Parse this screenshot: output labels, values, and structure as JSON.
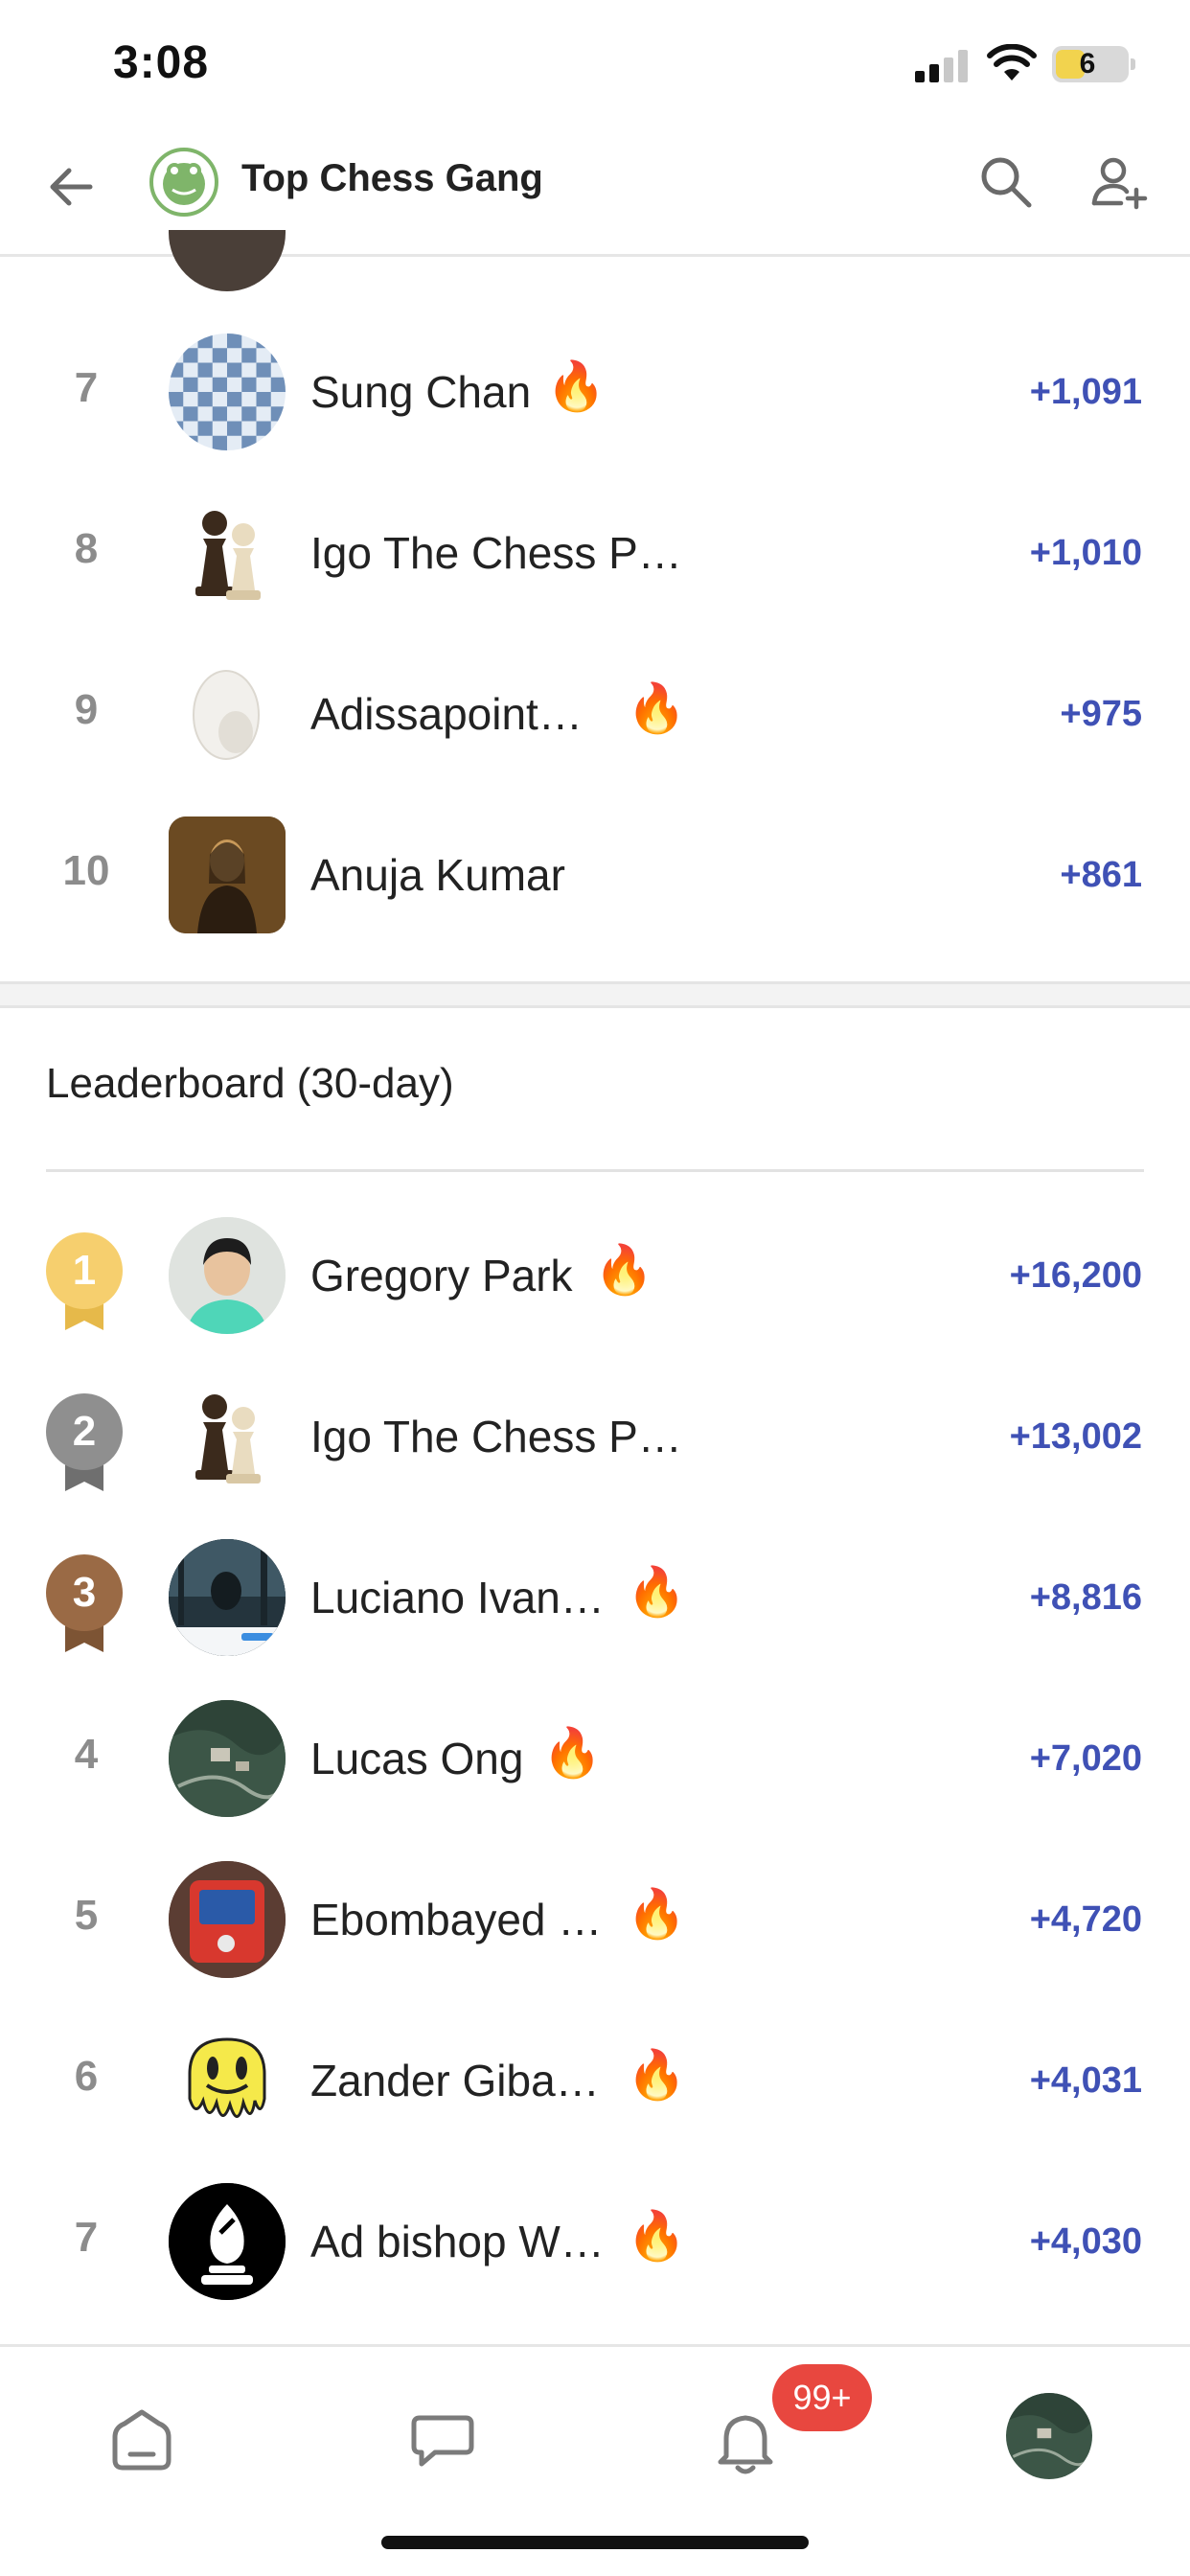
{
  "status_bar": {
    "time": "3:08",
    "battery": "6"
  },
  "header": {
    "title": "Top Chess Gang"
  },
  "weekly_rows": [
    {
      "rank": "7",
      "name": "Sung Chan",
      "score": "+1,091",
      "streak": true
    },
    {
      "rank": "8",
      "name": "Igo The Chess P…",
      "score": "+1,010",
      "streak": false
    },
    {
      "rank": "9",
      "name": "Adissapoint…",
      "score": "+975",
      "streak": true
    },
    {
      "rank": "10",
      "name": "Anuja Kumar",
      "score": "+861",
      "streak": false
    }
  ],
  "leaderboard": {
    "title": "Leaderboard (30-day)",
    "rows": [
      {
        "rank": "1",
        "name": "Gregory Park",
        "score": "+16,200",
        "streak": true
      },
      {
        "rank": "2",
        "name": "Igo The Chess P…",
        "score": "+13,002",
        "streak": false
      },
      {
        "rank": "3",
        "name": "Luciano Ivan…",
        "score": "+8,816",
        "streak": true
      },
      {
        "rank": "4",
        "name": "Lucas Ong",
        "score": "+7,020",
        "streak": true
      },
      {
        "rank": "5",
        "name": "Ebombayed …",
        "score": "+4,720",
        "streak": true
      },
      {
        "rank": "6",
        "name": "Zander Giba…",
        "score": "+4,031",
        "streak": true
      },
      {
        "rank": "7",
        "name": "Ad bishop W…",
        "score": "+4,030",
        "streak": true
      }
    ]
  },
  "bottom_nav": {
    "notifications_badge": "99+"
  },
  "icons": {
    "back": "arrow-left-icon",
    "search": "search-icon",
    "add_user": "add-user-icon",
    "home": "home-icon",
    "chat": "chat-icon",
    "notifications": "bell-icon",
    "streak": "fire-icon"
  },
  "colors": {
    "score": "#3f51b5",
    "gold": "#f6cf6e",
    "silver": "#8f8f8f",
    "bronze": "#9a6a45",
    "badge": "#e8473f"
  }
}
